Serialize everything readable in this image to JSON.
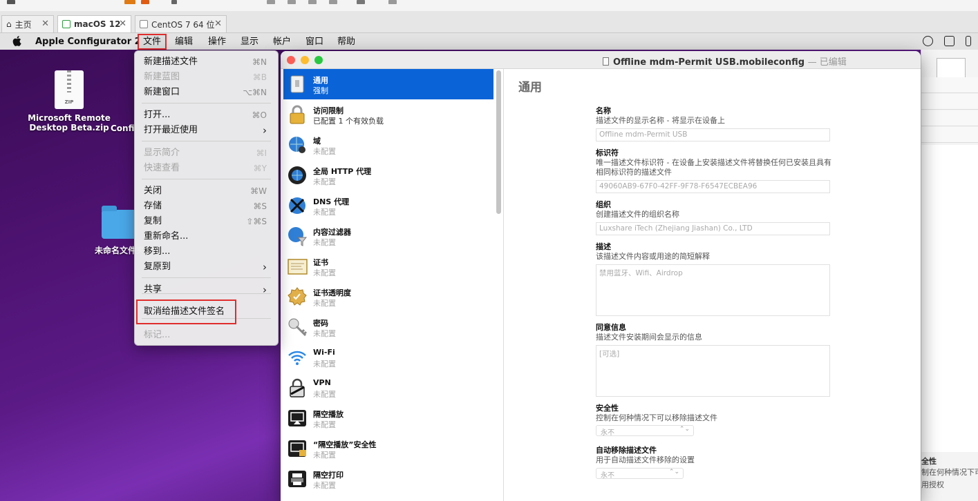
{
  "vm_tabs": [
    {
      "label": "主页",
      "active": false
    },
    {
      "label": "macOS 12",
      "active": true
    },
    {
      "label": "CentOS 7 64 位",
      "active": false
    }
  ],
  "menubar": {
    "app_name": "Apple Configurator 2",
    "items": [
      "文件",
      "编辑",
      "操作",
      "显示",
      "帐户",
      "窗口",
      "帮助"
    ]
  },
  "desktop": {
    "zip_label_line1": "Microsoft Remote",
    "zip_label_line2": "Desktop Beta.zip",
    "zip_badge": "ZIP",
    "second_label_partial": "Confi",
    "folder_label": "未命名文件夹"
  },
  "file_menu": {
    "items": [
      {
        "label": "新建描述文件",
        "shortcut": "⌘N",
        "enabled": true
      },
      {
        "label": "新建蓝图",
        "shortcut": "⌘B",
        "enabled": false
      },
      {
        "label": "新建窗口",
        "shortcut": "⌥⌘N",
        "enabled": true
      },
      {
        "label": "打开...",
        "shortcut": "⌘O",
        "enabled": true
      },
      {
        "label": "打开最近使用",
        "submenu": true,
        "enabled": true
      },
      {
        "label": "显示简介",
        "shortcut": "⌘I",
        "enabled": false
      },
      {
        "label": "快速查看",
        "shortcut": "⌘Y",
        "enabled": false
      },
      {
        "label": "关闭",
        "shortcut": "⌘W",
        "enabled": true
      },
      {
        "label": "存储",
        "shortcut": "⌘S",
        "enabled": true
      },
      {
        "label": "复制",
        "shortcut": "⇧⌘S",
        "enabled": true
      },
      {
        "label": "重新命名...",
        "enabled": true
      },
      {
        "label": "移到...",
        "enabled": true
      },
      {
        "label": "复原到",
        "submenu": true,
        "enabled": true
      },
      {
        "label": "共享",
        "submenu": true,
        "enabled": true
      },
      {
        "label": "取消给描述文件签名",
        "enabled": true
      },
      {
        "label": "标记...",
        "enabled": false
      }
    ]
  },
  "window": {
    "title": "Offline mdm-Permit USB.mobileconfig",
    "edited_suffix": "— 已编辑"
  },
  "sidebar": {
    "items": [
      {
        "name": "通用",
        "sub": "强制",
        "icon": "general-icon"
      },
      {
        "name": "访问限制",
        "sub": "已配置 1 个有效负载",
        "icon": "restrictions-lock-icon"
      },
      {
        "name": "域",
        "sub": "未配置",
        "icon": "domain-globe-icon"
      },
      {
        "name": "全局 HTTP 代理",
        "sub": "未配置",
        "icon": "http-proxy-icon"
      },
      {
        "name": "DNS 代理",
        "sub": "未配置",
        "icon": "dns-proxy-icon"
      },
      {
        "name": "内容过滤器",
        "sub": "未配置",
        "icon": "content-filter-icon"
      },
      {
        "name": "证书",
        "sub": "未配置",
        "icon": "certificate-icon"
      },
      {
        "name": "证书透明度",
        "sub": "未配置",
        "icon": "certificate-transparency-icon"
      },
      {
        "name": "密码",
        "sub": "未配置",
        "icon": "passcode-key-icon"
      },
      {
        "name": "Wi-Fi",
        "sub": "未配置",
        "icon": "wifi-icon"
      },
      {
        "name": "VPN",
        "sub": "未配置",
        "icon": "vpn-lock-icon"
      },
      {
        "name": "隔空播放",
        "sub": "未配置",
        "icon": "airplay-icon"
      },
      {
        "name": "“隔空播放”安全性",
        "sub": "未配置",
        "icon": "airplay-security-icon"
      },
      {
        "name": "隔空打印",
        "sub": "未配置",
        "icon": "airprint-icon"
      }
    ]
  },
  "content": {
    "heading": "通用",
    "name_label": "名称",
    "name_desc": "描述文件的显示名称 - 将显示在设备上",
    "name_value": "Offline mdm-Permit USB",
    "identifier_label": "标识符",
    "identifier_desc": "唯一描述文件标识符 - 在设备上安装描述文件将替换任何已安装且具有相同标识符的描述文件",
    "identifier_value": "49060AB9-67F0-42FF-9F78-F6547ECBEA96",
    "org_label": "组织",
    "org_desc": "创建描述文件的组织名称",
    "org_value": "Luxshare iTech (Zhejiang Jiashan) Co., LTD",
    "desc_label": "描述",
    "desc_desc": "该描述文件内容或用途的简短解释",
    "desc_value": "禁用蓝牙、Wifi、Airdrop",
    "consent_label": "同意信息",
    "consent_desc": "描述文件安装期间会显示的信息",
    "consent_placeholder": "[可选]",
    "security_label": "安全性",
    "security_desc": "控制在何种情况下可以移除描述文件",
    "security_value": "永不",
    "autoremove_label": "自动移除描述文件",
    "autoremove_desc": "用于自动描述文件移除的设置",
    "autoremove_value": "永不"
  },
  "bg_window": {
    "text1": "全性",
    "text2": "制在何种情况下可",
    "text3": "用授权"
  },
  "colors": {
    "selection_blue": "#0a64d8",
    "highlight_red": "#e02c2c",
    "traffic_red": "#fe5f57",
    "traffic_yellow": "#febc2e",
    "traffic_green": "#28c840"
  }
}
